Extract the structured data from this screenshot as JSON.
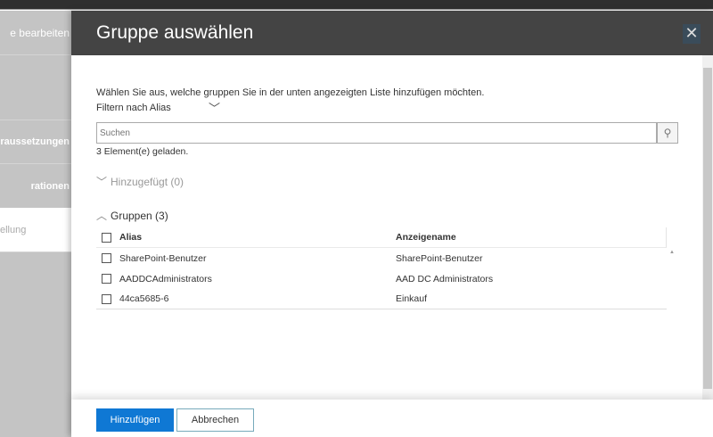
{
  "sidebar": {
    "items": [
      {
        "label": "e bearbeiten"
      },
      {
        "label": ""
      },
      {
        "label": "voraussetzungen"
      },
      {
        "label": "rationen"
      },
      {
        "label": "ellung"
      }
    ]
  },
  "dialog": {
    "title": "Gruppe auswählen",
    "close_icon": "close-icon",
    "description": "Wählen Sie aus, welche gruppen Sie in der unten angezeigten Liste hinzufügen möchten.",
    "filter_label": "Filtern nach Alias",
    "search_placeholder": "Suchen",
    "loaded_text": "3 Element(e) geladen.",
    "added_section": "Hinzugefügt (0)",
    "groups_section": "Gruppen (3)",
    "table": {
      "headers": [
        "Alias",
        "Anzeigename"
      ],
      "rows": [
        {
          "alias": "SharePoint-Benutzer",
          "name": "SharePoint-Benutzer"
        },
        {
          "alias": "AADDCAdministrators",
          "name": "AAD DC Administrators"
        },
        {
          "alias": "44ca5685-6",
          "name": "Einkauf"
        }
      ]
    },
    "add_button": "Hinzufügen",
    "cancel_button": "Abbrechen"
  },
  "colors": {
    "header": "#444444",
    "primary": "#0f78d4"
  }
}
